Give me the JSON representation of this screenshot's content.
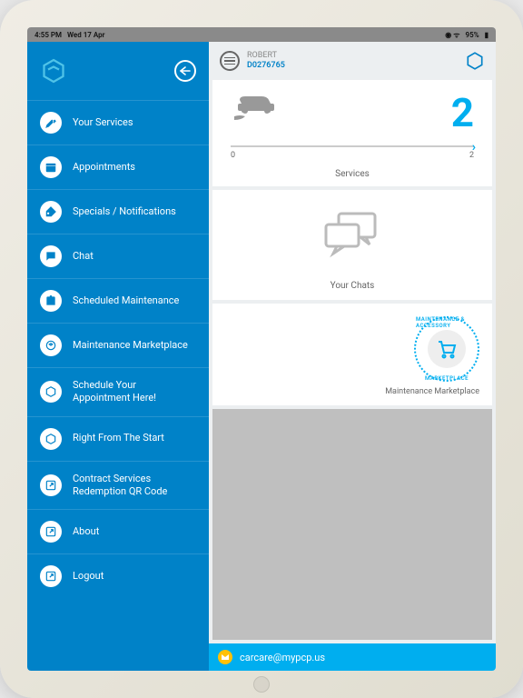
{
  "status": {
    "time": "4:55 PM",
    "date": "Wed 17 Apr",
    "battery": "95%"
  },
  "header": {
    "user_name": "ROBERT",
    "user_id": "D0276765"
  },
  "sidebar": {
    "items": [
      {
        "label": "Your Services"
      },
      {
        "label": "Appointments"
      },
      {
        "label": "Specials / Notifications"
      },
      {
        "label": "Chat"
      },
      {
        "label": "Scheduled Maintenance"
      },
      {
        "label": "Maintenance Marketplace"
      },
      {
        "label": "Schedule Your Appointment Here!"
      },
      {
        "label": "Right From The Start"
      },
      {
        "label": "Contract Services Redemption QR Code"
      },
      {
        "label": "About"
      },
      {
        "label": "Logout"
      }
    ]
  },
  "services": {
    "count": "2",
    "min": "0",
    "max": "2",
    "caption": "Services"
  },
  "chats": {
    "caption": "Your Chats"
  },
  "marketplace": {
    "top_label": "MAINTENANCE & ACCESSORY",
    "bottom_label": "MARKETPLACE",
    "caption": "Maintenance Marketplace"
  },
  "footer": {
    "email": "carcare@mypcp.us"
  },
  "colors": {
    "primary": "#0082c8",
    "accent": "#00aeef",
    "footer_icon": "#ffc107"
  }
}
